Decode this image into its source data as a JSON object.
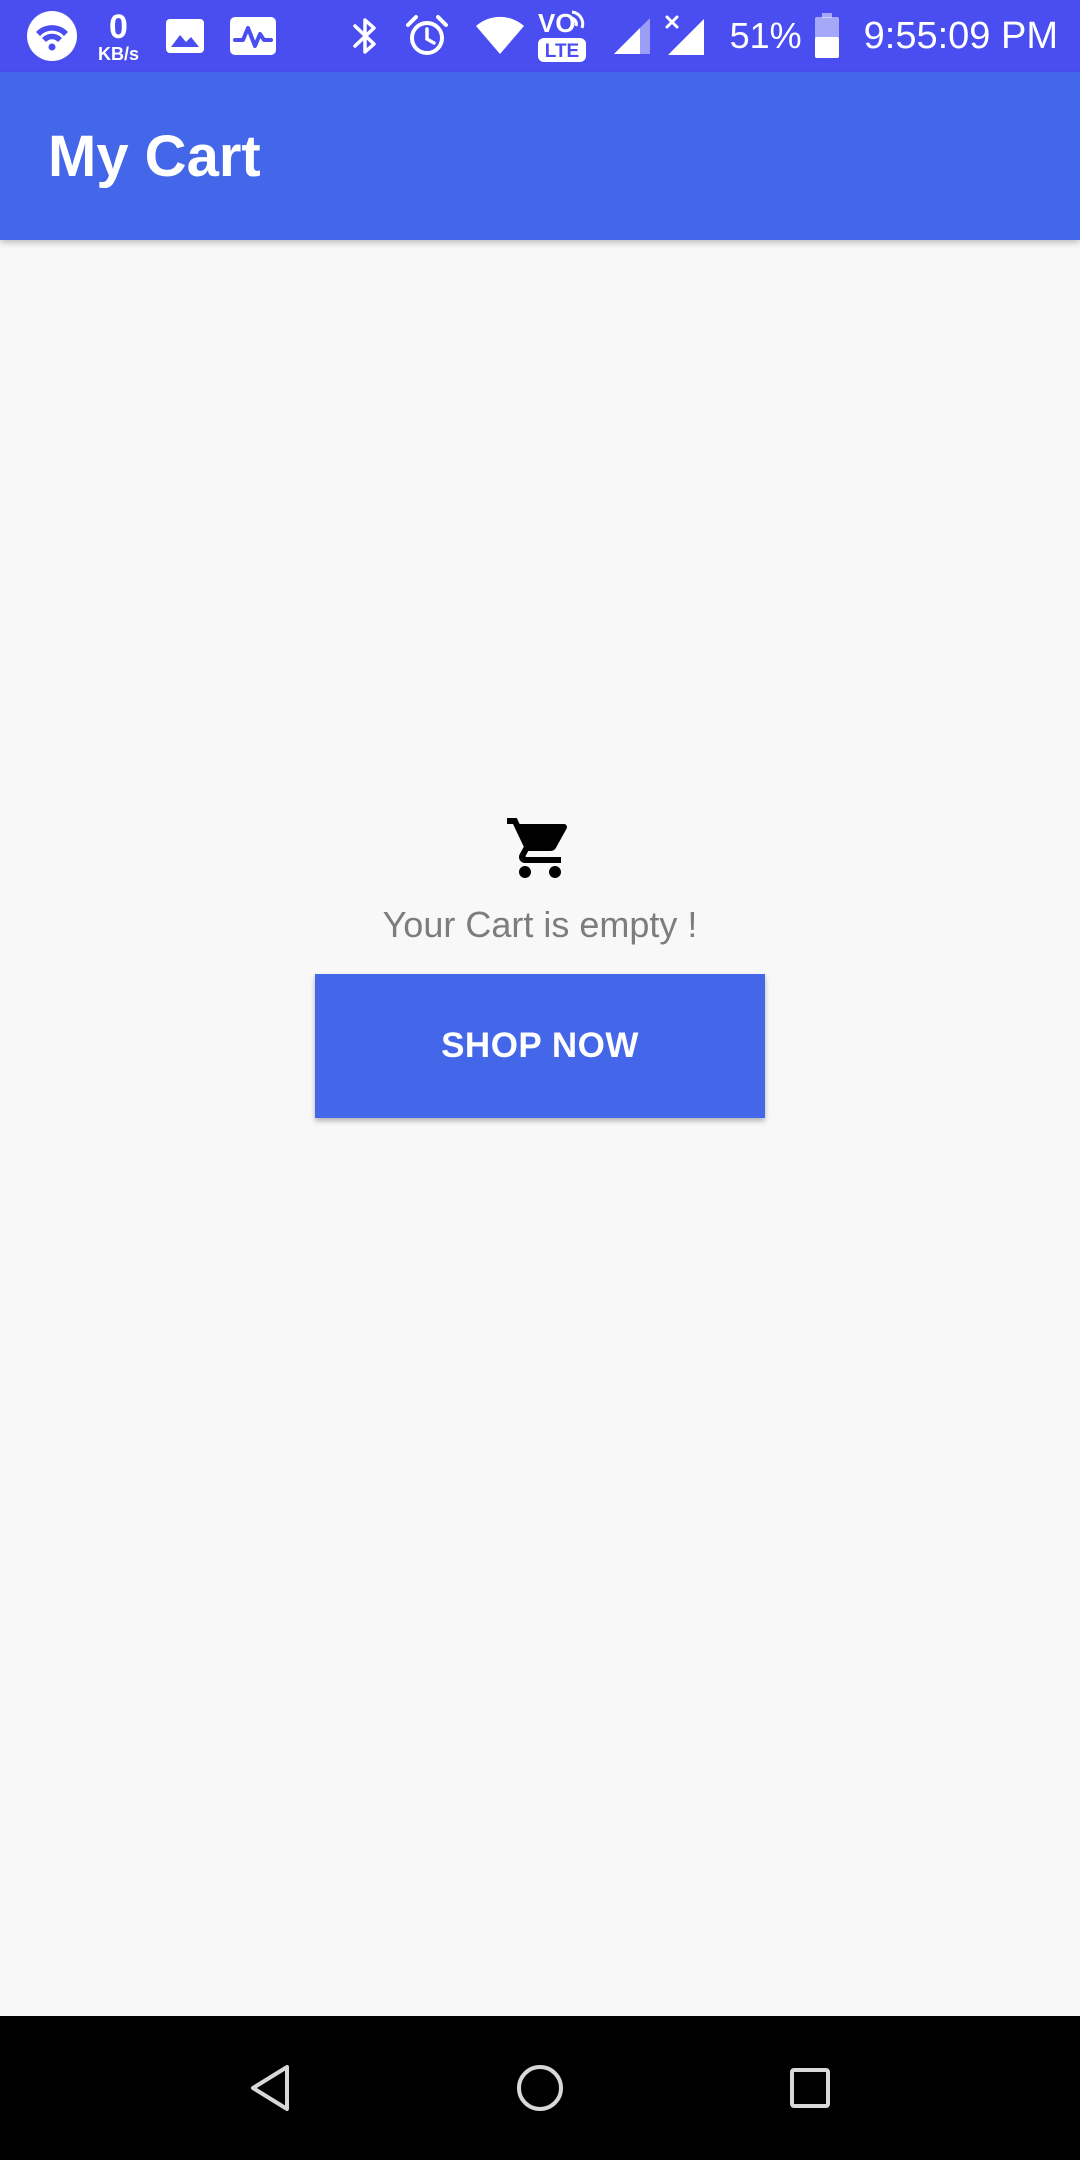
{
  "status_bar": {
    "speed_value": "0",
    "speed_unit": "KB/s",
    "volte_label": "VO",
    "lte_label": "LTE",
    "battery_percent": "51%",
    "battery_level": 0.51,
    "time": "9:55:09 PM",
    "icons": [
      "wifi-icon",
      "gallery-icon",
      "activity-icon",
      "bluetooth-icon",
      "alarm-icon",
      "wifi-signal-icon",
      "volte-icon",
      "signal-icon",
      "signal-no-data-icon",
      "battery-icon"
    ]
  },
  "app_bar": {
    "title": "My Cart"
  },
  "empty_state": {
    "icon": "cart-icon",
    "message": "Your Cart is empty !",
    "button_label": "SHOP NOW"
  },
  "nav_bar": {
    "icons": [
      "back-icon",
      "home-icon",
      "recents-icon"
    ]
  },
  "colors": {
    "status_bar": "#4a4ef0",
    "primary": "#4466e8",
    "background": "#f8f8f8",
    "message_text": "#7d7d7d"
  }
}
